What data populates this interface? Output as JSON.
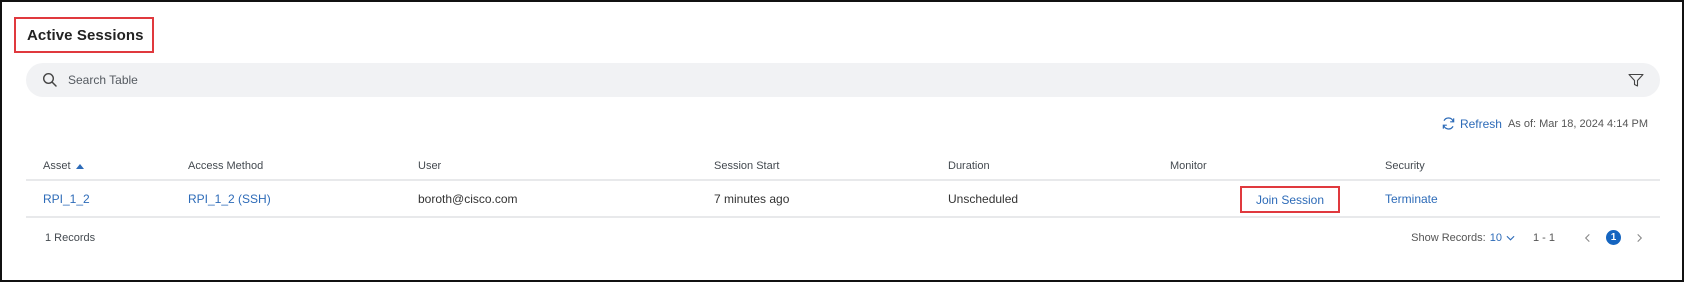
{
  "title": "Active Sessions",
  "search": {
    "placeholder": "Search Table"
  },
  "icons": {
    "search": "search-icon",
    "filter": "filter-icon",
    "refresh": "refresh-icon",
    "sort": "sort-ascending-icon"
  },
  "toolbar": {
    "refresh_label": "Refresh",
    "as_of": "As of: Mar 18, 2024 4:14 PM"
  },
  "table": {
    "columns": [
      "Asset",
      "Access Method",
      "User",
      "Session Start",
      "Duration",
      "Monitor",
      "Security"
    ],
    "sort_column": "Asset",
    "sort_direction": "ascending",
    "rows": [
      {
        "asset": "RPI_1_2",
        "access_method": "RPI_1_2 (SSH)",
        "user": "boroth@cisco.com",
        "session_start": "7 minutes ago",
        "duration": "Unscheduled",
        "monitor": "Join Session",
        "security": "Terminate"
      }
    ]
  },
  "footer": {
    "records": "1 Records",
    "show_records_label": "Show Records:",
    "show_records_value": "10",
    "range": "1 - 1",
    "current_page": "1"
  },
  "colors": {
    "accent": "#2d6bb8",
    "highlight_border": "#e0393e",
    "page_active": "#1565c0"
  }
}
